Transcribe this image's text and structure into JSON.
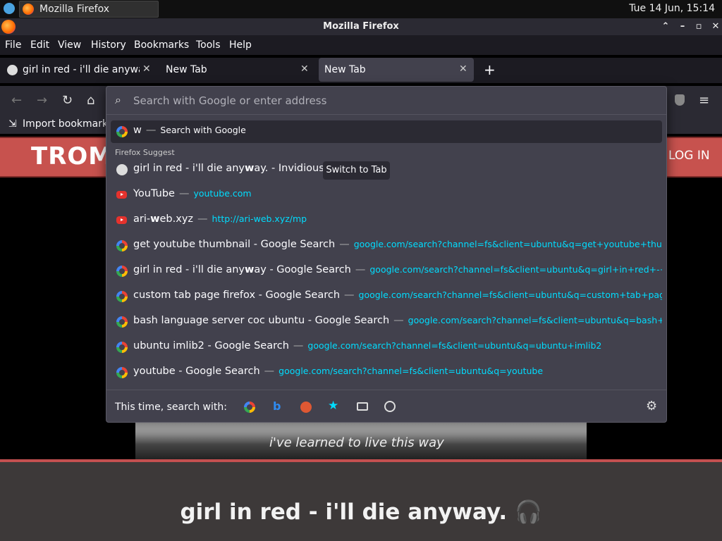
{
  "panel": {
    "task_title": "Mozilla Firefox",
    "clock": "Tue 14 Jun, 15:14"
  },
  "window": {
    "title": "Mozilla Firefox"
  },
  "menu": [
    "File",
    "Edit",
    "View",
    "History",
    "Bookmarks",
    "Tools",
    "Help"
  ],
  "tabs": [
    {
      "label": "girl in red - i'll die anyway. - Invidious"
    },
    {
      "label": "New Tab"
    },
    {
      "label": "New Tab"
    }
  ],
  "bookmarks": {
    "import_label": "Import bookmarks..."
  },
  "site": {
    "logo_text": "TROM",
    "login": "LOG IN"
  },
  "urlbar": {
    "placeholder": "Search with Google or enter address"
  },
  "top_result": {
    "query": "w",
    "action": "Search with Google"
  },
  "section_label": "Firefox Suggest",
  "switch_tab_label": "Switch to Tab",
  "results": [
    {
      "pre": "girl in red - i'll die any",
      "bold": "w",
      "post": "ay. - Invidious",
      "url": "",
      "icon": "invidious-icon"
    },
    {
      "pre": "YouTube",
      "bold": "",
      "post": "",
      "url": "youtube.com",
      "icon": "youtube-icon"
    },
    {
      "pre": "ari-",
      "bold": "w",
      "post": "eb.xyz",
      "url": "http://ari-web.xyz/mp",
      "icon": "youtube-icon"
    },
    {
      "pre": "get youtube thumbnail - Google Search",
      "bold": "",
      "post": "",
      "url": "google.com/search?channel=fs&client=ubuntu&q=get+youtube+thumb",
      "icon": "google-icon"
    },
    {
      "pre": "girl in red - i'll die any",
      "bold": "w",
      "post": "ay - Google Search",
      "url": "google.com/search?channel=fs&client=ubuntu&q=girl+in+red+-+i'll",
      "icon": "google-icon"
    },
    {
      "pre": "custom tab page firefox - Google Search",
      "bold": "",
      "post": "",
      "url": "google.com/search?channel=fs&client=ubuntu&q=custom+tab+page+",
      "icon": "google-icon"
    },
    {
      "pre": "bash language server coc ubuntu - Google Search",
      "bold": "",
      "post": "",
      "url": "google.com/search?channel=fs&client=ubuntu&q=bash+lan",
      "icon": "google-icon"
    },
    {
      "pre": "ubuntu imlib2 - Google Search",
      "bold": "",
      "post": "",
      "url": "google.com/search?channel=fs&client=ubuntu&q=ubuntu+imlib2",
      "icon": "google-icon"
    },
    {
      "pre": "youtube - Google Search",
      "bold": "",
      "post": "",
      "url": "google.com/search?channel=fs&client=ubuntu&q=youtube",
      "icon": "google-icon"
    }
  ],
  "one_off": {
    "label": "This time, search with:",
    "engines": [
      "google-icon",
      "bing-icon",
      "duckduckgo-icon",
      "bookmarks-icon",
      "tabs-icon",
      "history-icon"
    ]
  },
  "video": {
    "caption": "i've learned to live this way"
  },
  "song_title": "girl in red - i'll die anyway. 🎧"
}
